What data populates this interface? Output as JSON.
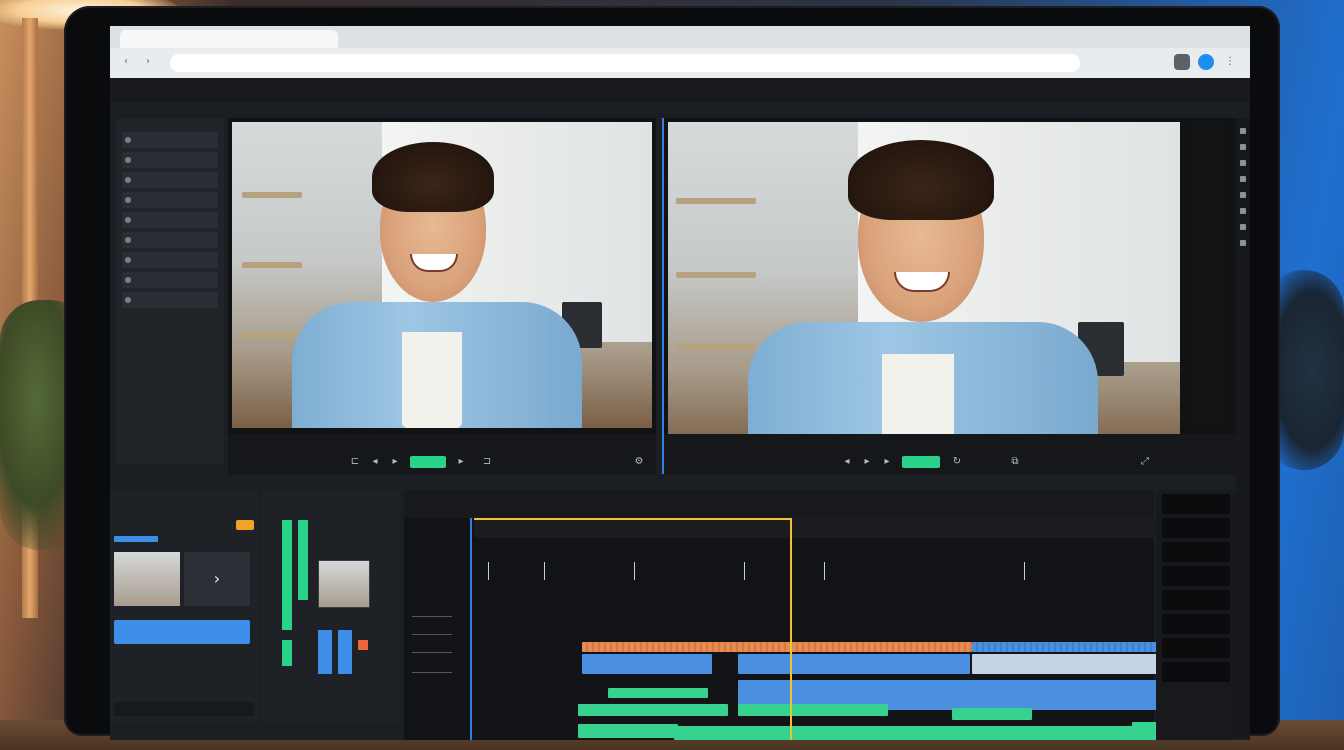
{
  "browser": {
    "tab_title": "",
    "url": ""
  },
  "menu": [
    "",
    "",
    "",
    "",
    "",
    "",
    "",
    "",
    "",
    ""
  ],
  "left_panel_items": [
    "",
    "",
    "",
    "",
    "",
    "",
    "",
    "",
    ""
  ],
  "viewer_left": {
    "title": "",
    "bottom_label_left": "",
    "bottom_label_center": "",
    "bottom_label_right": ""
  },
  "viewer_right": {
    "title": "",
    "bottom_label_left": "",
    "bottom_label_center": ""
  },
  "project": {
    "title": "",
    "button_label": ""
  },
  "timeline": {
    "ruler_labels": [
      "",
      "",
      "",
      "",
      "",
      "",
      ""
    ],
    "markers": [
      "",
      "",
      "",
      ""
    ]
  },
  "colors": {
    "accent_blue": "#3c8ee6",
    "clip_green": "#35d38f",
    "clip_blue": "#4a8fe0",
    "playhead": "#f0c330"
  }
}
